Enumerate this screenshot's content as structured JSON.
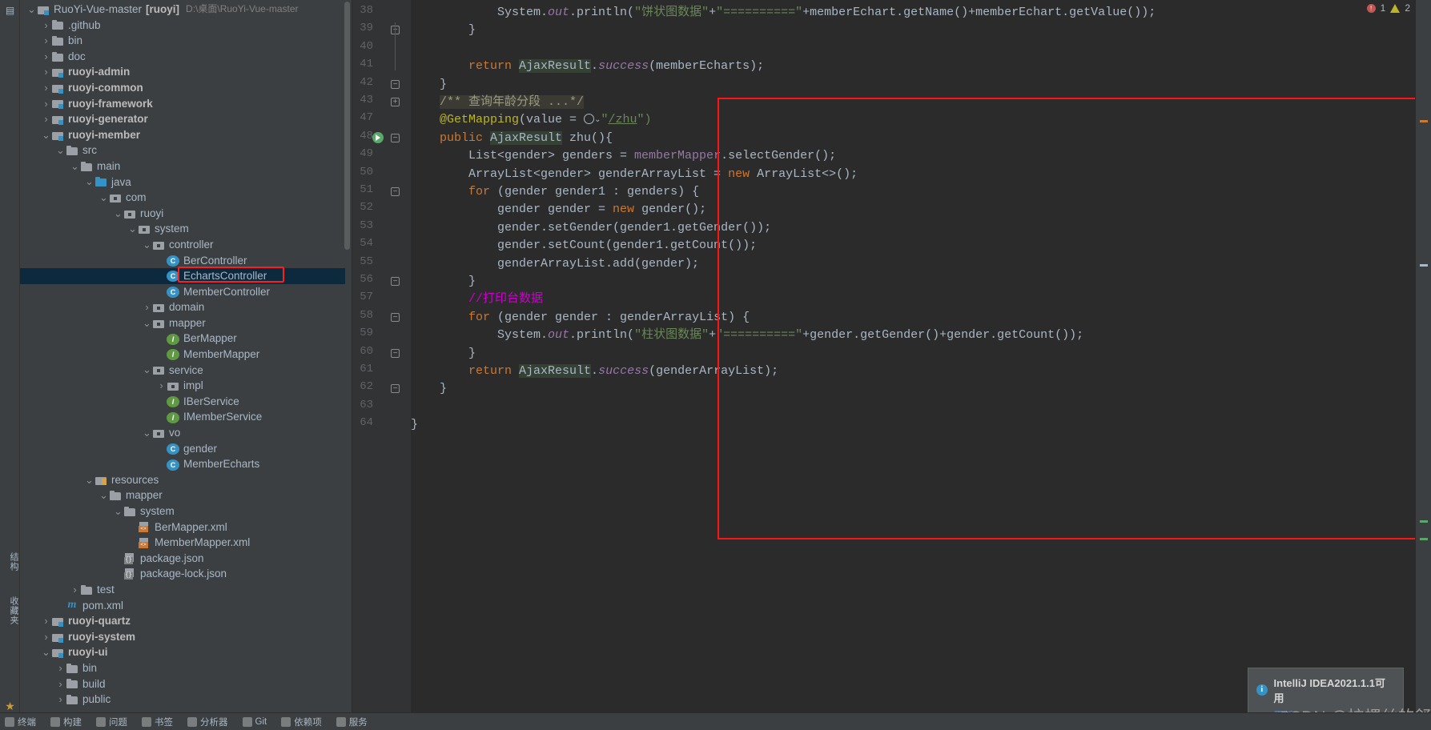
{
  "window": {
    "title": "RuoYi-Vue-master",
    "project_label": "[ruoyi]",
    "project_path": "D:\\桌面\\RuoYi-Vue-master"
  },
  "left_strip": {
    "items": [
      {
        "label": "结构",
        "name": "structure-tool-button"
      },
      {
        "label": "收藏夹",
        "name": "favorites-tool-button"
      }
    ],
    "project_icon": "project-folder-icon",
    "star_icon": "star-icon"
  },
  "tree": {
    "selected": "EchartsController",
    "rows": [
      {
        "indent": 0,
        "arrow": "v",
        "icon": "root-module-icon",
        "label": "RuoYi-Vue-master",
        "style": "plain",
        "suffix": "[ruoyi]",
        "path": "D:\\桌面\\RuoYi-Vue-master"
      },
      {
        "indent": 1,
        "arrow": ">",
        "icon": "folder-icon",
        "label": ".github",
        "style": "plain"
      },
      {
        "indent": 1,
        "arrow": ">",
        "icon": "folder-icon",
        "label": "bin",
        "style": "plain"
      },
      {
        "indent": 1,
        "arrow": ">",
        "icon": "folder-icon",
        "label": "doc",
        "style": "plain"
      },
      {
        "indent": 1,
        "arrow": ">",
        "icon": "module-icon",
        "label": "ruoyi-admin",
        "style": "bold"
      },
      {
        "indent": 1,
        "arrow": ">",
        "icon": "module-icon",
        "label": "ruoyi-common",
        "style": "bold"
      },
      {
        "indent": 1,
        "arrow": ">",
        "icon": "module-icon",
        "label": "ruoyi-framework",
        "style": "bold"
      },
      {
        "indent": 1,
        "arrow": ">",
        "icon": "module-icon",
        "label": "ruoyi-generator",
        "style": "bold"
      },
      {
        "indent": 1,
        "arrow": "v",
        "icon": "module-icon",
        "label": "ruoyi-member",
        "style": "bold"
      },
      {
        "indent": 2,
        "arrow": "v",
        "icon": "folder-icon",
        "label": "src",
        "style": "plain"
      },
      {
        "indent": 3,
        "arrow": "v",
        "icon": "folder-icon",
        "label": "main",
        "style": "plain"
      },
      {
        "indent": 4,
        "arrow": "v",
        "icon": "source-folder-icon",
        "label": "java",
        "style": "plain"
      },
      {
        "indent": 5,
        "arrow": "v",
        "icon": "package-icon",
        "label": "com",
        "style": "plain"
      },
      {
        "indent": 6,
        "arrow": "v",
        "icon": "package-icon",
        "label": "ruoyi",
        "style": "plain"
      },
      {
        "indent": 7,
        "arrow": "v",
        "icon": "package-icon",
        "label": "system",
        "style": "plain"
      },
      {
        "indent": 8,
        "arrow": "v",
        "icon": "package-icon",
        "label": "controller",
        "style": "plain"
      },
      {
        "indent": 9,
        "arrow": "-",
        "icon": "class-icon",
        "label": "BerController",
        "style": "plain"
      },
      {
        "indent": 9,
        "arrow": "-",
        "icon": "class-icon",
        "label": "EchartsController",
        "style": "plain",
        "selected": true
      },
      {
        "indent": 9,
        "arrow": "-",
        "icon": "class-icon",
        "label": "MemberController",
        "style": "plain"
      },
      {
        "indent": 8,
        "arrow": ">",
        "icon": "package-icon",
        "label": "domain",
        "style": "plain"
      },
      {
        "indent": 8,
        "arrow": "v",
        "icon": "package-icon",
        "label": "mapper",
        "style": "plain"
      },
      {
        "indent": 9,
        "arrow": "-",
        "icon": "interface-icon",
        "label": "BerMapper",
        "style": "plain"
      },
      {
        "indent": 9,
        "arrow": "-",
        "icon": "interface-icon",
        "label": "MemberMapper",
        "style": "plain"
      },
      {
        "indent": 8,
        "arrow": "v",
        "icon": "package-icon",
        "label": "service",
        "style": "plain"
      },
      {
        "indent": 9,
        "arrow": ">",
        "icon": "package-icon",
        "label": "impl",
        "style": "plain"
      },
      {
        "indent": 9,
        "arrow": "-",
        "icon": "interface-icon",
        "label": "IBerService",
        "style": "plain"
      },
      {
        "indent": 9,
        "arrow": "-",
        "icon": "interface-icon",
        "label": "IMemberService",
        "style": "plain"
      },
      {
        "indent": 8,
        "arrow": "v",
        "icon": "package-icon",
        "label": "vo",
        "style": "plain"
      },
      {
        "indent": 9,
        "arrow": "-",
        "icon": "class-icon",
        "label": "gender",
        "style": "plain"
      },
      {
        "indent": 9,
        "arrow": "-",
        "icon": "class-icon",
        "label": "MemberEcharts",
        "style": "plain"
      },
      {
        "indent": 4,
        "arrow": "v",
        "icon": "resources-icon",
        "label": "resources",
        "style": "plain"
      },
      {
        "indent": 5,
        "arrow": "v",
        "icon": "folder-icon",
        "label": "mapper",
        "style": "plain"
      },
      {
        "indent": 6,
        "arrow": "v",
        "icon": "folder-icon",
        "label": "system",
        "style": "plain"
      },
      {
        "indent": 7,
        "arrow": "-",
        "icon": "xml-file-icon",
        "label": "BerMapper.xml",
        "style": "plain"
      },
      {
        "indent": 7,
        "arrow": "-",
        "icon": "xml-file-icon",
        "label": "MemberMapper.xml",
        "style": "plain"
      },
      {
        "indent": 6,
        "arrow": "-",
        "icon": "json-file-icon",
        "label": "package.json",
        "style": "plain"
      },
      {
        "indent": 6,
        "arrow": "-",
        "icon": "json-file-icon",
        "label": "package-lock.json",
        "style": "plain"
      },
      {
        "indent": 3,
        "arrow": ">",
        "icon": "folder-icon",
        "label": "test",
        "style": "plain"
      },
      {
        "indent": 2,
        "arrow": "-",
        "icon": "maven-icon",
        "label": "pom.xml",
        "style": "plain"
      },
      {
        "indent": 1,
        "arrow": ">",
        "icon": "module-icon",
        "label": "ruoyi-quartz",
        "style": "bold"
      },
      {
        "indent": 1,
        "arrow": ">",
        "icon": "module-icon",
        "label": "ruoyi-system",
        "style": "bold"
      },
      {
        "indent": 1,
        "arrow": "v",
        "icon": "module-icon",
        "label": "ruoyi-ui",
        "style": "bold"
      },
      {
        "indent": 2,
        "arrow": ">",
        "icon": "folder-icon",
        "label": "bin",
        "style": "plain"
      },
      {
        "indent": 2,
        "arrow": ">",
        "icon": "folder-icon",
        "label": "build",
        "style": "plain"
      },
      {
        "indent": 2,
        "arrow": ">",
        "icon": "folder-icon",
        "label": "public",
        "style": "plain"
      }
    ]
  },
  "editor": {
    "first_line_number": 38,
    "lines": [
      {
        "num": "38",
        "fold": "",
        "segments": [
          {
            "t": "            System.",
            "c": "plain"
          },
          {
            "t": "out",
            "c": "stat"
          },
          {
            "t": ".println(",
            "c": "plain"
          },
          {
            "t": "\"饼状图数据\"",
            "c": "str"
          },
          {
            "t": "+",
            "c": "plain"
          },
          {
            "t": "\"==========\"",
            "c": "str"
          },
          {
            "t": "+memberEchart.getName()+memberEchart.getValue());",
            "c": "plain"
          }
        ]
      },
      {
        "num": "39",
        "fold": "minus",
        "segments": [
          {
            "t": "        }",
            "c": "plain"
          }
        ]
      },
      {
        "num": "40",
        "fold": "",
        "segments": [
          {
            "t": "",
            "c": "plain"
          }
        ]
      },
      {
        "num": "41",
        "fold": "",
        "segments": [
          {
            "t": "        ",
            "c": "plain"
          },
          {
            "t": "return ",
            "c": "kw"
          },
          {
            "t": "AjaxResult",
            "c": "hl"
          },
          {
            "t": ".",
            "c": "plain"
          },
          {
            "t": "success",
            "c": "stat"
          },
          {
            "t": "(memberEcharts);",
            "c": "plain"
          }
        ]
      },
      {
        "num": "42",
        "fold": "minus",
        "segments": [
          {
            "t": "    }",
            "c": "plain"
          }
        ]
      },
      {
        "num": "43",
        "fold": "plus",
        "segments": [
          {
            "t": "    ",
            "c": "plain"
          },
          {
            "t": "/** 查询年龄分段 ...*/",
            "c": "foldtxt"
          }
        ]
      },
      {
        "num": "47",
        "fold": "",
        "segments": [
          {
            "t": "    ",
            "c": "plain"
          },
          {
            "t": "@GetMapping",
            "c": "anno"
          },
          {
            "t": "(value = ",
            "c": "plain"
          },
          {
            "t": "@GLOBE@",
            "c": "icon"
          },
          {
            "t": "\"",
            "c": "str"
          },
          {
            "t": "/zhu",
            "c": "lnk"
          },
          {
            "t": "\")",
            "c": "str"
          }
        ]
      },
      {
        "num": "48",
        "fold": "minus",
        "run": true,
        "segments": [
          {
            "t": "    ",
            "c": "plain"
          },
          {
            "t": "public ",
            "c": "kw"
          },
          {
            "t": "AjaxResult",
            "c": "hl"
          },
          {
            "t": " zhu(){",
            "c": "plain"
          }
        ]
      },
      {
        "num": "49",
        "fold": "",
        "segments": [
          {
            "t": "        List<gender> genders = ",
            "c": "plain"
          },
          {
            "t": "memberMapper",
            "c": "fld"
          },
          {
            "t": ".selectGender();",
            "c": "plain"
          }
        ]
      },
      {
        "num": "50",
        "fold": "",
        "segments": [
          {
            "t": "        ArrayList<gender> genderArrayList = ",
            "c": "plain"
          },
          {
            "t": "new ",
            "c": "kw"
          },
          {
            "t": "ArrayList<>();",
            "c": "plain"
          }
        ]
      },
      {
        "num": "51",
        "fold": "minus",
        "segments": [
          {
            "t": "        ",
            "c": "plain"
          },
          {
            "t": "for ",
            "c": "kw"
          },
          {
            "t": "(gender gender1 : genders) {",
            "c": "plain"
          }
        ]
      },
      {
        "num": "52",
        "fold": "",
        "segments": [
          {
            "t": "            gender gender = ",
            "c": "plain"
          },
          {
            "t": "new ",
            "c": "kw"
          },
          {
            "t": "gender();",
            "c": "plain"
          }
        ]
      },
      {
        "num": "53",
        "fold": "",
        "segments": [
          {
            "t": "            gender.setGender(gender1.getGender());",
            "c": "plain"
          }
        ]
      },
      {
        "num": "54",
        "fold": "",
        "segments": [
          {
            "t": "            gender.setCount(gender1.getCount());",
            "c": "plain"
          }
        ]
      },
      {
        "num": "55",
        "fold": "",
        "segments": [
          {
            "t": "            genderArrayList.add(gender);",
            "c": "plain"
          }
        ]
      },
      {
        "num": "56",
        "fold": "minus",
        "segments": [
          {
            "t": "        }",
            "c": "plain"
          }
        ]
      },
      {
        "num": "57",
        "fold": "",
        "segments": [
          {
            "t": "        ",
            "c": "plain"
          },
          {
            "t": "//打印台数据",
            "c": "cmt2"
          }
        ]
      },
      {
        "num": "58",
        "fold": "minus",
        "segments": [
          {
            "t": "        ",
            "c": "plain"
          },
          {
            "t": "for ",
            "c": "kw"
          },
          {
            "t": "(gender gender : genderArrayList) {",
            "c": "plain"
          }
        ]
      },
      {
        "num": "59",
        "fold": "",
        "segments": [
          {
            "t": "            System.",
            "c": "plain"
          },
          {
            "t": "out",
            "c": "stat"
          },
          {
            "t": ".println(",
            "c": "plain"
          },
          {
            "t": "\"柱状图数据\"",
            "c": "str"
          },
          {
            "t": "+",
            "c": "plain"
          },
          {
            "t": "\"==========\"",
            "c": "str"
          },
          {
            "t": "+gender.getGender()+gender.getCount());",
            "c": "plain"
          }
        ]
      },
      {
        "num": "60",
        "fold": "minus",
        "segments": [
          {
            "t": "        }",
            "c": "plain"
          }
        ]
      },
      {
        "num": "61",
        "fold": "",
        "segments": [
          {
            "t": "        ",
            "c": "plain"
          },
          {
            "t": "return ",
            "c": "kw"
          },
          {
            "t": "AjaxResult",
            "c": "hl"
          },
          {
            "t": ".",
            "c": "plain"
          },
          {
            "t": "success",
            "c": "stat"
          },
          {
            "t": "(genderArrayList);",
            "c": "plain"
          }
        ]
      },
      {
        "num": "62",
        "fold": "minus",
        "segments": [
          {
            "t": "    }",
            "c": "plain"
          }
        ]
      },
      {
        "num": "63",
        "fold": "",
        "segments": [
          {
            "t": "",
            "c": "plain"
          }
        ]
      },
      {
        "num": "64",
        "fold": "",
        "segments": [
          {
            "t": "}",
            "c": "plain"
          }
        ]
      }
    ]
  },
  "annotations": {
    "red_box_label": "highlight-rectangle",
    "tree_red_box_label": "selected-file-highlight"
  },
  "status_indicators": {
    "error_count": "1",
    "error_icon": "error-circle-icon",
    "warning_icon": "warning-triangle-icon",
    "warning_count": "2"
  },
  "notification": {
    "icon": "info-icon",
    "title": "IntelliJ IDEA2021.1.1可用",
    "link": "更新..."
  },
  "watermark": {
    "text": "CSDN @拧螺丝的舒克"
  },
  "statusbar": {
    "items": [
      {
        "label": "终端",
        "name": "statusbar-terminal"
      },
      {
        "label": "构建",
        "name": "statusbar-build"
      },
      {
        "label": "问题",
        "name": "statusbar-problems"
      },
      {
        "label": "书签",
        "name": "statusbar-bookmarks"
      },
      {
        "label": "分析器",
        "name": "statusbar-profiler"
      },
      {
        "label": "Git",
        "name": "statusbar-git"
      },
      {
        "label": "依赖项",
        "name": "statusbar-dependencies"
      },
      {
        "label": "服务",
        "name": "statusbar-services"
      }
    ]
  },
  "colors": {
    "accent": "#3592c4",
    "highlight_red": "#ff1414",
    "selection_blue": "#0d293e",
    "editor_bg": "#2b2b2b",
    "panel_bg": "#3c3f41"
  }
}
